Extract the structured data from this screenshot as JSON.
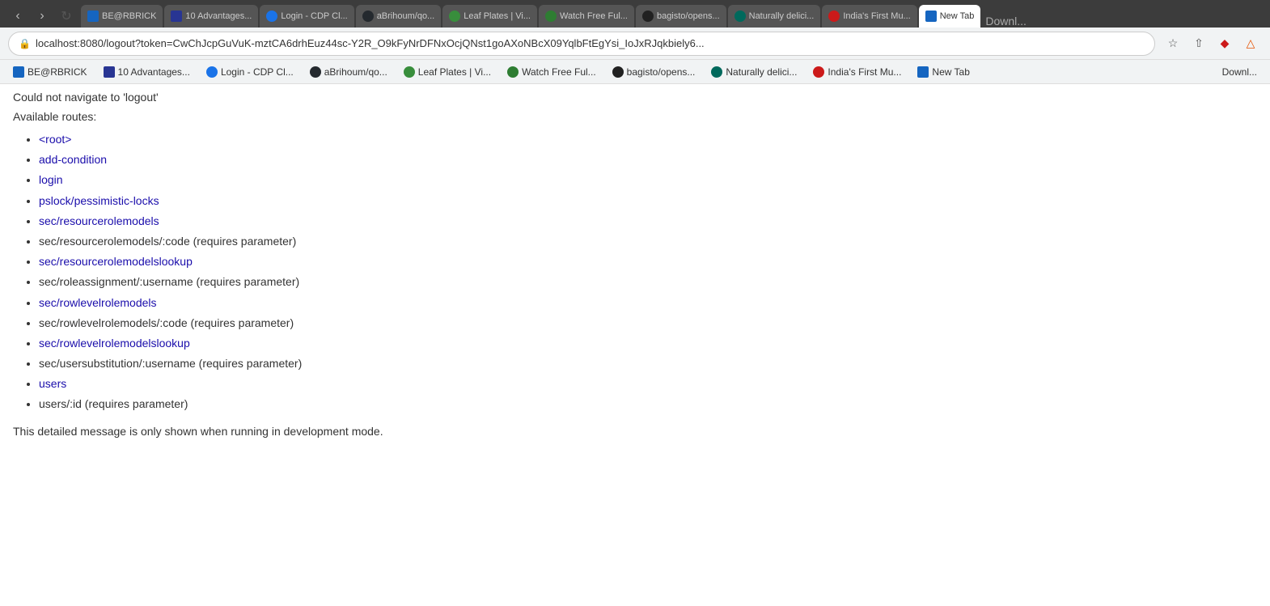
{
  "browser": {
    "nav": {
      "back_disabled": true,
      "forward_disabled": true,
      "reload_label": "↻",
      "address": "localhost:8080/logout?token=CwChJcpGuVuK-mztCA6drhEuz44sc-Y2R_O9kFyNrDFNxOcjQNst1goAXoNBcX09YqlbFtEgYsi_IoJxRJqkbiely6...",
      "address_short": "localhost:8080/logout?token=CwChJcpGuVuK-mztCA6drhEuz44sc-Y2R_O9kFyNrDFNxOcjQNst1goAXoNBcX09YqlbFtEgYsi_IoJxRJqkbiely6..."
    },
    "tabs": [
      {
        "id": "be-rbrick",
        "label": "BE@RBRICK",
        "active": false,
        "favicon_color": "fav-blue"
      },
      {
        "id": "10-advantages",
        "label": "10 Advantages...",
        "active": false,
        "favicon_color": "fav-dark-blue"
      },
      {
        "id": "login-cdp",
        "label": "Login - CDP Cl...",
        "active": false,
        "favicon_color": "fav-blue"
      },
      {
        "id": "abrihoum",
        "label": "aBrihoum/qo...",
        "active": false,
        "favicon_color": "fav-black"
      },
      {
        "id": "leaf-plates",
        "label": "Leaf Plates | Vi...",
        "active": false,
        "favicon_color": "fav-green"
      },
      {
        "id": "watch-free",
        "label": "Watch Free Ful...",
        "active": false,
        "favicon_color": "fav-green"
      },
      {
        "id": "bagisto",
        "label": "bagisto/opens...",
        "active": false,
        "favicon_color": "fav-black"
      },
      {
        "id": "naturally-delici",
        "label": "Naturally delici...",
        "active": false,
        "favicon_color": "fav-teal"
      },
      {
        "id": "indias-first",
        "label": "India's First Mu...",
        "active": false,
        "favicon_color": "fav-red"
      },
      {
        "id": "new-tab",
        "label": "New Tab",
        "active": true,
        "favicon_color": "fav-globe"
      }
    ],
    "bookmarks": [
      {
        "id": "be-rbrick-bm",
        "label": "BE@RBRICK",
        "favicon_color": "fav-blue"
      },
      {
        "id": "10-advantages-bm",
        "label": "10 Advantages...",
        "favicon_color": "fav-dark-blue"
      },
      {
        "id": "login-cdp-bm",
        "label": "Login - CDP Cl...",
        "favicon_color": "fav-blue"
      },
      {
        "id": "abrihoum-bm",
        "label": "aBrihoum/qo...",
        "favicon_color": "fav-black"
      },
      {
        "id": "leaf-plates-bm",
        "label": "Leaf Plates | Vi...",
        "favicon_color": "fav-green"
      },
      {
        "id": "watch-free-bm",
        "label": "Watch Free Ful...",
        "favicon_color": "fav-green"
      },
      {
        "id": "bagisto-bm",
        "label": "bagisto/opens...",
        "favicon_color": "fav-black"
      },
      {
        "id": "naturally-bm",
        "label": "Naturally delici...",
        "favicon_color": "fav-teal"
      },
      {
        "id": "indias-first-bm",
        "label": "India's First Mu...",
        "favicon_color": "fav-red"
      },
      {
        "id": "new-tab-bm",
        "label": "New Tab",
        "favicon_color": "fav-globe"
      }
    ],
    "downloads_label": "Downl..."
  },
  "page": {
    "error_message": "Could not navigate to 'logout'",
    "available_routes_label": "Available routes:",
    "routes": [
      {
        "id": "root",
        "text": "<root>",
        "is_link": true,
        "href": "/"
      },
      {
        "id": "add-condition",
        "text": "add-condition",
        "is_link": true,
        "href": "/add-condition"
      },
      {
        "id": "login",
        "text": "login",
        "is_link": true,
        "href": "/login"
      },
      {
        "id": "pslock",
        "text": "pslock/pessimistic-locks",
        "is_link": true,
        "href": "/pslock/pessimistic-locks"
      },
      {
        "id": "sec-resourcerolemodels",
        "text": "sec/resourcerolemodels",
        "is_link": true,
        "href": "/sec/resourcerolemodels"
      },
      {
        "id": "sec-resourcerolemodels-code",
        "text": "sec/resourcerolemodels/:code (requires parameter)",
        "is_link": false
      },
      {
        "id": "sec-resourcerolemodelslookup",
        "text": "sec/resourcerolemodelslookup",
        "is_link": true,
        "href": "/sec/resourcerolemodelslookup"
      },
      {
        "id": "sec-roleassignment",
        "text": "sec/roleassignment/:username (requires parameter)",
        "is_link": false
      },
      {
        "id": "sec-rowlevelrolemodels",
        "text": "sec/rowlevelrolemodels",
        "is_link": true,
        "href": "/sec/rowlevelrolemodels"
      },
      {
        "id": "sec-rowlevelrolemodels-code",
        "text": "sec/rowlevelrolemodels/:code (requires parameter)",
        "is_link": false
      },
      {
        "id": "sec-rowlevelrolemodelslookup",
        "text": "sec/rowlevelrolemodelslookup",
        "is_link": true,
        "href": "/sec/rowlevelrolemodelslookup"
      },
      {
        "id": "sec-usersubstitution",
        "text": "sec/usersubstitution/:username (requires parameter)",
        "is_link": false
      },
      {
        "id": "users",
        "text": "users",
        "is_link": true,
        "href": "/users"
      },
      {
        "id": "users-id",
        "text": "users/:id (requires parameter)",
        "is_link": false
      }
    ],
    "dev_mode_note": "This detailed message is only shown when running in development mode."
  }
}
